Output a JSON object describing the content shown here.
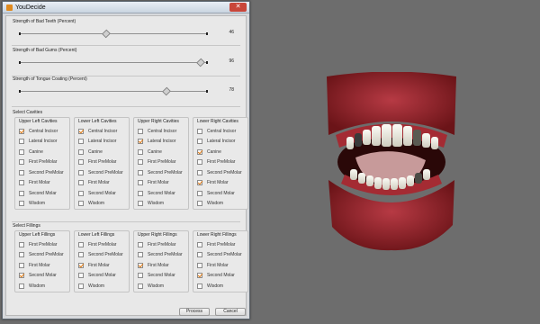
{
  "window": {
    "title": "YouDecide",
    "close_label": "✕"
  },
  "sliders": [
    {
      "label": "Strength of Bad Teeth (Percent)",
      "value": 46,
      "display": "46"
    },
    {
      "label": "Strength of Bad Gums (Percent)",
      "value": 96,
      "display": "96"
    },
    {
      "label": "Strength of Tongue Coating (Percent)",
      "value": 78,
      "display": "78"
    }
  ],
  "cavities": {
    "section_label": "Select Cavities",
    "groups": [
      {
        "title": "Upper Left Cavities",
        "items": [
          {
            "label": "Central Incisor",
            "checked": true
          },
          {
            "label": "Lateral Incisor",
            "checked": false
          },
          {
            "label": "Canine",
            "checked": false
          },
          {
            "label": "First PreMolar",
            "checked": false
          },
          {
            "label": "Second PreMolar",
            "checked": false
          },
          {
            "label": "First Molar",
            "checked": false
          },
          {
            "label": "Second Molar",
            "checked": false
          },
          {
            "label": "Wisdom",
            "checked": false
          }
        ]
      },
      {
        "title": "Lower Left Cavities",
        "items": [
          {
            "label": "Central Incisor",
            "checked": true
          },
          {
            "label": "Lateral Incisor",
            "checked": false
          },
          {
            "label": "Canine",
            "checked": false
          },
          {
            "label": "First PreMolar",
            "checked": false
          },
          {
            "label": "Second PreMolar",
            "checked": false
          },
          {
            "label": "First Molar",
            "checked": false
          },
          {
            "label": "Second Molar",
            "checked": false
          },
          {
            "label": "Wisdom",
            "checked": false
          }
        ]
      },
      {
        "title": "Upper Right Cavities",
        "items": [
          {
            "label": "Central Incisor",
            "checked": false
          },
          {
            "label": "Lateral Incisor",
            "checked": true
          },
          {
            "label": "Canine",
            "checked": false
          },
          {
            "label": "First PreMolar",
            "checked": false
          },
          {
            "label": "Second PreMolar",
            "checked": false
          },
          {
            "label": "First Molar",
            "checked": false
          },
          {
            "label": "Second Molar",
            "checked": false
          },
          {
            "label": "Wisdom",
            "checked": false
          }
        ]
      },
      {
        "title": "Lower Right Cavities",
        "items": [
          {
            "label": "Central Incisor",
            "checked": false
          },
          {
            "label": "Lateral Incisor",
            "checked": false
          },
          {
            "label": "Canine",
            "checked": true
          },
          {
            "label": "First PreMolar",
            "checked": false
          },
          {
            "label": "Second PreMolar",
            "checked": false
          },
          {
            "label": "First Molar",
            "checked": true
          },
          {
            "label": "Second Molar",
            "checked": false
          },
          {
            "label": "Wisdom",
            "checked": false
          }
        ]
      }
    ]
  },
  "fillings": {
    "section_label": "Select Fillings",
    "groups": [
      {
        "title": "Upper Left Fillings",
        "items": [
          {
            "label": "First PreMolar",
            "checked": false
          },
          {
            "label": "Second PreMolar",
            "checked": false
          },
          {
            "label": "First Molar",
            "checked": false
          },
          {
            "label": "Second Molar",
            "checked": true
          },
          {
            "label": "Wisdom",
            "checked": false
          }
        ]
      },
      {
        "title": "Lower Left Fillings",
        "items": [
          {
            "label": "First PreMolar",
            "checked": false
          },
          {
            "label": "Second PreMolar",
            "checked": false
          },
          {
            "label": "First Molar",
            "checked": true
          },
          {
            "label": "Second Molar",
            "checked": false
          },
          {
            "label": "Wisdom",
            "checked": false
          }
        ]
      },
      {
        "title": "Upper Right Fillings",
        "items": [
          {
            "label": "First PreMolar",
            "checked": false
          },
          {
            "label": "Second PreMolar",
            "checked": false
          },
          {
            "label": "First Molar",
            "checked": true
          },
          {
            "label": "Second Molar",
            "checked": false
          },
          {
            "label": "Wisdom",
            "checked": false
          }
        ]
      },
      {
        "title": "Lower Right Fillings",
        "items": [
          {
            "label": "First PreMolar",
            "checked": false
          },
          {
            "label": "Second PreMolar",
            "checked": false
          },
          {
            "label": "First Molar",
            "checked": false
          },
          {
            "label": "Second Molar",
            "checked": true
          },
          {
            "label": "Wisdom",
            "checked": false
          }
        ]
      }
    ]
  },
  "buttons": {
    "process": "Process",
    "cancel": "Cancel"
  },
  "colors": {
    "viewport_bg": "#6d6d6d",
    "check_accent": "#e07a12",
    "gum": "#8c1f24"
  }
}
